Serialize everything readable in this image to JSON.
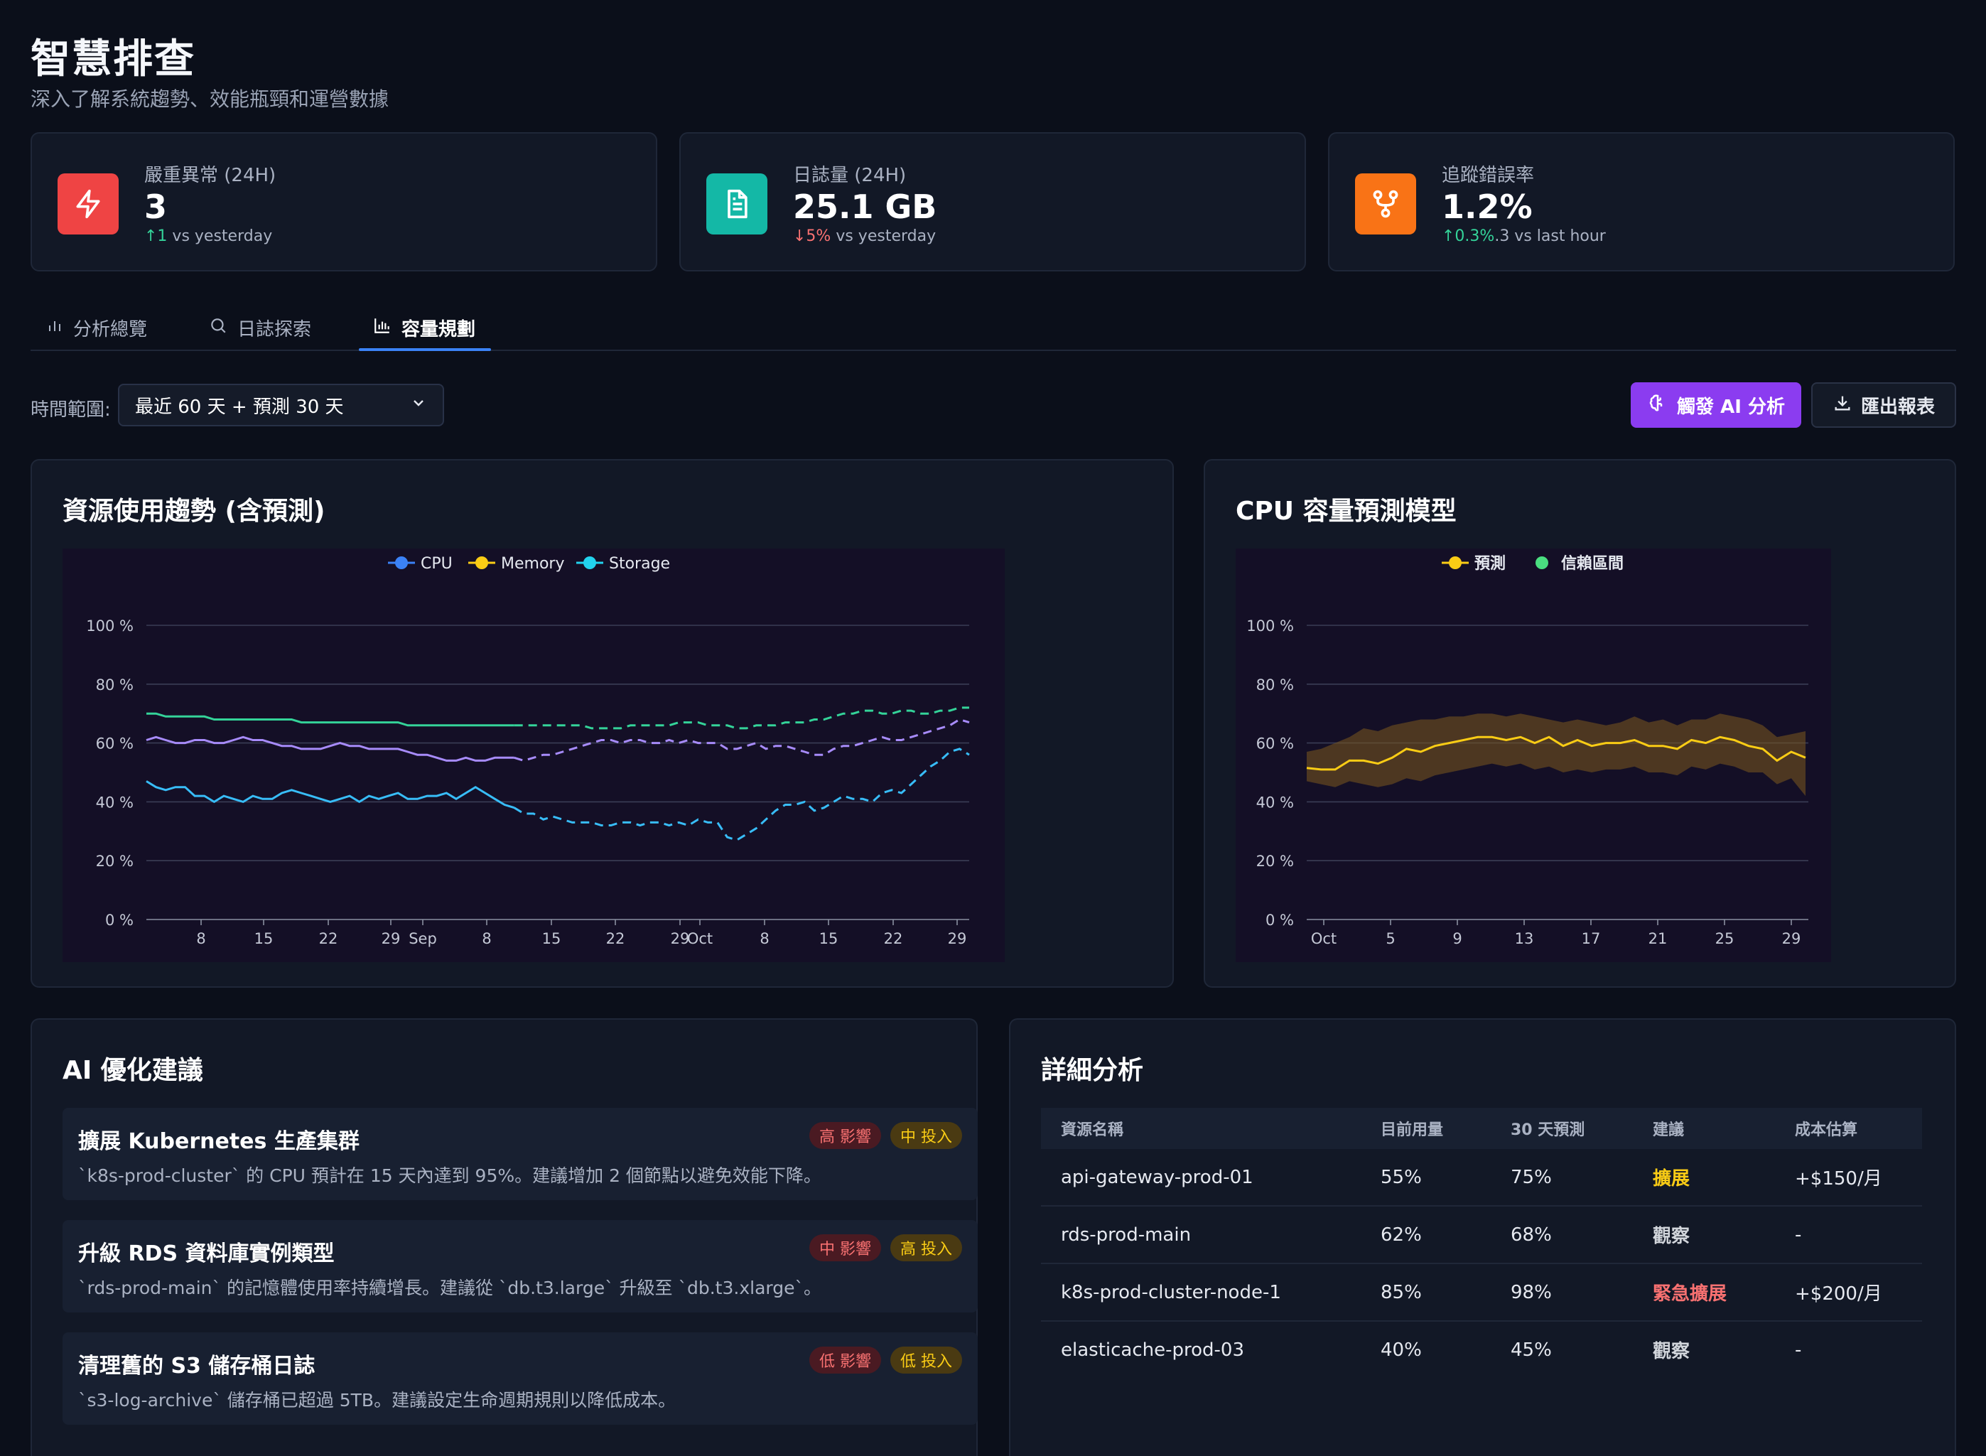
{
  "header": {
    "title": "智慧排查",
    "subtitle": "深入了解系統趨勢、效能瓶頸和運營數據"
  },
  "kpis": [
    {
      "label": "嚴重異常 (24H)",
      "value": "3",
      "delta": "↑1",
      "delta_suffix": " vs yesterday",
      "color": "#ef4444",
      "icon": "bolt-icon"
    },
    {
      "label": "日誌量 (24H)",
      "value": "25.1 GB",
      "delta": "↓5%",
      "delta_suffix": " vs yesterday",
      "color": "#14b8a6",
      "icon": "file-text-icon"
    },
    {
      "label": "追蹤錯誤率",
      "value": "1.2%",
      "delta": "↑0.3%",
      "delta_suffix": ".3 vs last hour",
      "color": "#f97316",
      "icon": "trace-branch-icon"
    }
  ],
  "tabs": [
    {
      "label": "分析總覽",
      "icon": "bar-chart-icon"
    },
    {
      "label": "日誌探索",
      "icon": "search-icon"
    },
    {
      "label": "容量規劃",
      "icon": "column-chart-icon",
      "active": true
    }
  ],
  "toolbar": {
    "range_label": "時間範圍:",
    "range_value": "最近 60 天 + 預測 30 天",
    "ai_button": "觸發 AI 分析",
    "export_button": "匯出報表"
  },
  "chart_data": [
    {
      "type": "line",
      "title": "資源使用趨勢 (含預測)",
      "ylim": [
        0,
        100
      ],
      "yticks": [
        "100 %",
        "80 %",
        "60 %",
        "40 %",
        "20 %",
        "0 %"
      ],
      "xticks": [
        "8",
        "15",
        "22",
        "29",
        "Sep",
        "8",
        "15",
        "22",
        "29",
        "Oct",
        "8",
        "15",
        "22",
        "29"
      ],
      "legend": [
        "CPU",
        "Memory",
        "Storage"
      ],
      "legend_colors": [
        "#3b82f6",
        "#facc15",
        "#22d3ee"
      ],
      "forecast_start_index": 38,
      "series": [
        {
          "name": "CPU",
          "color": "#38bdf8",
          "values": [
            47,
            45,
            44,
            45,
            45,
            42,
            42,
            40,
            42,
            41,
            40,
            42,
            41,
            41,
            43,
            44,
            43,
            42,
            41,
            40,
            41,
            42,
            40,
            42,
            41,
            42,
            43,
            41,
            41,
            42,
            42,
            43,
            41,
            43,
            45,
            43,
            41,
            39,
            38,
            36,
            36,
            34,
            35,
            34,
            33,
            33,
            33,
            32,
            32,
            33,
            33,
            32,
            33,
            33,
            32,
            33,
            32,
            34,
            33,
            33,
            28,
            27,
            29,
            31,
            34,
            37,
            39,
            39,
            40,
            37,
            38,
            40,
            42,
            41,
            41,
            40,
            43,
            44,
            43,
            46,
            49,
            52,
            54,
            57,
            58,
            56
          ]
        },
        {
          "name": "Memory",
          "color": "#a78bfa",
          "values": [
            61,
            62,
            61,
            60,
            60,
            61,
            61,
            60,
            60,
            61,
            62,
            61,
            61,
            60,
            59,
            59,
            58,
            58,
            58,
            59,
            60,
            59,
            59,
            58,
            58,
            58,
            58,
            57,
            56,
            56,
            55,
            54,
            54,
            55,
            54,
            54,
            55,
            55,
            55,
            54,
            55,
            56,
            56,
            57,
            58,
            59,
            60,
            61,
            61,
            60,
            61,
            61,
            60,
            60,
            61,
            60,
            61,
            60,
            60,
            60,
            58,
            58,
            59,
            60,
            58,
            59,
            59,
            58,
            57,
            56,
            56,
            58,
            59,
            59,
            60,
            61,
            62,
            61,
            61,
            62,
            63,
            64,
            65,
            66,
            68,
            67
          ]
        },
        {
          "name": "Storage",
          "color": "#34d399",
          "values": [
            70,
            70,
            69,
            69,
            69,
            69,
            69,
            68,
            68,
            68,
            68,
            68,
            68,
            68,
            68,
            68,
            67,
            67,
            67,
            67,
            67,
            67,
            67,
            67,
            67,
            67,
            67,
            66,
            66,
            66,
            66,
            66,
            66,
            66,
            66,
            66,
            66,
            66,
            66,
            66,
            66,
            66,
            66,
            66,
            66,
            66,
            65,
            65,
            65,
            65,
            66,
            66,
            66,
            66,
            66,
            67,
            67,
            67,
            66,
            66,
            66,
            65,
            65,
            66,
            66,
            66,
            67,
            67,
            67,
            68,
            68,
            69,
            70,
            70,
            71,
            71,
            70,
            70,
            71,
            71,
            70,
            70,
            71,
            71,
            72,
            72
          ]
        }
      ]
    },
    {
      "type": "line",
      "title": "CPU 容量預測模型",
      "ylim": [
        0,
        100
      ],
      "yticks": [
        "100 %",
        "80 %",
        "60 %",
        "40 %",
        "20 %",
        "0 %"
      ],
      "xticks": [
        "Oct",
        "5",
        "9",
        "13",
        "17",
        "21",
        "25",
        "29"
      ],
      "legend": [
        "預測",
        "信賴區間"
      ],
      "legend_colors": [
        "#facc15",
        "#4ade80"
      ],
      "series": [
        {
          "name": "預測",
          "color": "#facc15",
          "values": [
            51.5,
            51,
            51,
            54,
            54,
            53,
            55,
            58,
            57,
            59,
            60,
            61,
            62,
            62,
            61,
            62,
            60,
            62,
            59,
            61,
            59,
            60,
            60,
            61,
            59,
            59,
            58,
            61,
            60,
            62,
            61,
            59,
            58,
            54,
            57,
            55
          ]
        },
        {
          "name": "信賴區間",
          "color": "#7c5a1e",
          "upper": [
            57,
            58,
            60,
            62,
            65,
            64,
            66,
            67,
            68,
            68,
            69,
            69,
            70,
            70,
            69,
            70,
            69,
            68,
            67,
            68,
            67,
            66,
            67,
            69,
            67,
            68,
            66,
            68,
            68,
            70,
            69,
            68,
            66,
            62,
            63,
            64
          ],
          "lower": [
            47,
            46,
            45,
            47,
            46,
            45,
            46,
            48,
            47,
            49,
            50,
            51,
            52,
            53,
            52,
            53,
            51,
            52,
            50,
            51,
            50,
            51,
            51,
            52,
            50,
            50,
            49,
            52,
            51,
            53,
            52,
            50,
            50,
            46,
            48,
            42
          ]
        }
      ]
    }
  ],
  "recommendations": {
    "title": "AI 優化建議",
    "items": [
      {
        "title": "擴展 Kubernetes 生產集群",
        "desc": "`k8s-prod-cluster` 的 CPU 預計在 15 天內達到 95%。建議增加 2 個節點以避免效能下降。",
        "impact": "高 影響",
        "effort": "中 投入"
      },
      {
        "title": "升級 RDS 資料庫實例類型",
        "desc": "`rds-prod-main` 的記憶體使用率持續增長。建議從 `db.t3.large` 升級至 `db.t3.xlarge`。",
        "impact": "中 影響",
        "effort": "高 投入"
      },
      {
        "title": "清理舊的 S3 儲存桶日誌",
        "desc": "`s3-log-archive` 儲存桶已超過 5TB。建議設定生命週期規則以降低成本。",
        "impact": "低 影響",
        "effort": "低 投入"
      }
    ]
  },
  "detail": {
    "title": "詳細分析",
    "columns": [
      "資源名稱",
      "目前用量",
      "30 天預測",
      "建議",
      "成本估算"
    ],
    "rows": [
      {
        "name": "api-gateway-prod-01",
        "current": "55%",
        "forecast": "75%",
        "advice": "擴展",
        "advice_color": "#facc15",
        "cost": "+$150/月"
      },
      {
        "name": "rds-prod-main",
        "current": "62%",
        "forecast": "68%",
        "advice": "觀察",
        "advice_color": "#d1d5db",
        "cost": "-"
      },
      {
        "name": "k8s-prod-cluster-node-1",
        "current": "85%",
        "forecast": "98%",
        "advice": "緊急擴展",
        "advice_color": "#f87171",
        "cost": "+$200/月"
      },
      {
        "name": "elasticache-prod-03",
        "current": "40%",
        "forecast": "45%",
        "advice": "觀察",
        "advice_color": "#d1d5db",
        "cost": "-"
      }
    ]
  }
}
